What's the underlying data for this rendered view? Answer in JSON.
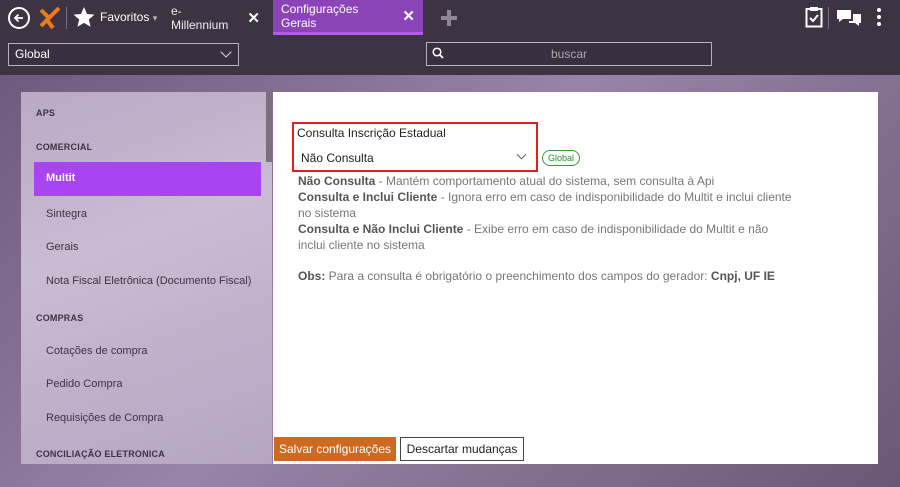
{
  "topbar": {
    "favorites_label": "Favoritos",
    "favorites_caret": "▾",
    "tabs": [
      {
        "label": "e-Millennium",
        "close": "✕"
      },
      {
        "label": "Configurações Gerais",
        "close": "✕"
      }
    ]
  },
  "toolbar": {
    "scope_select_value": "Global",
    "search_placeholder": "buscar"
  },
  "sidebar": {
    "sections": [
      {
        "heading": "APS",
        "items": []
      },
      {
        "heading": "COMERCIAL",
        "items": [
          "Multit",
          "Sintegra",
          "Gerais",
          "Nota Fiscal Eletrônica (Documento Fiscal)"
        ]
      },
      {
        "heading": "COMPRAS",
        "items": [
          "Cotações de compra",
          "Pedido Compra",
          "Requisições de Compra"
        ]
      },
      {
        "heading": "CONCILIAÇÃO ELETRONICA",
        "items": []
      }
    ],
    "active_item": "Multit"
  },
  "form": {
    "field_label": "Consulta Inscrição Estadual",
    "field_value": "Não Consulta",
    "scope_badge": "Global",
    "options_help": [
      {
        "name": "Não Consulta",
        "text": " - Mantém comportamento atual do sistema, sem consulta à Api"
      },
      {
        "name": "Consulta e Inclui Cliente",
        "text": " - Ignora erro em caso de indisponibilidade do Multit e inclui cliente no sistema"
      },
      {
        "name": "Consulta e Não Inclui Cliente",
        "text": " - Exibe erro em caso de indisponibilidade do Multit e não inclui cliente no sistema"
      }
    ],
    "obs_label": "Obs:",
    "obs_text": " Para a consulta é obrigatório o preenchimento dos campos do gerador: ",
    "obs_fields": "Cnpj, UF IE"
  },
  "actions": {
    "save_label": "Salvar configurações",
    "discard_label": "Descartar mudanças"
  },
  "colors": {
    "accent": "#a844f2",
    "active_tab": "#8a44b8",
    "save_button": "#cc6a21",
    "highlight_box": "#e02020",
    "badge_green": "#2f8a2f"
  }
}
